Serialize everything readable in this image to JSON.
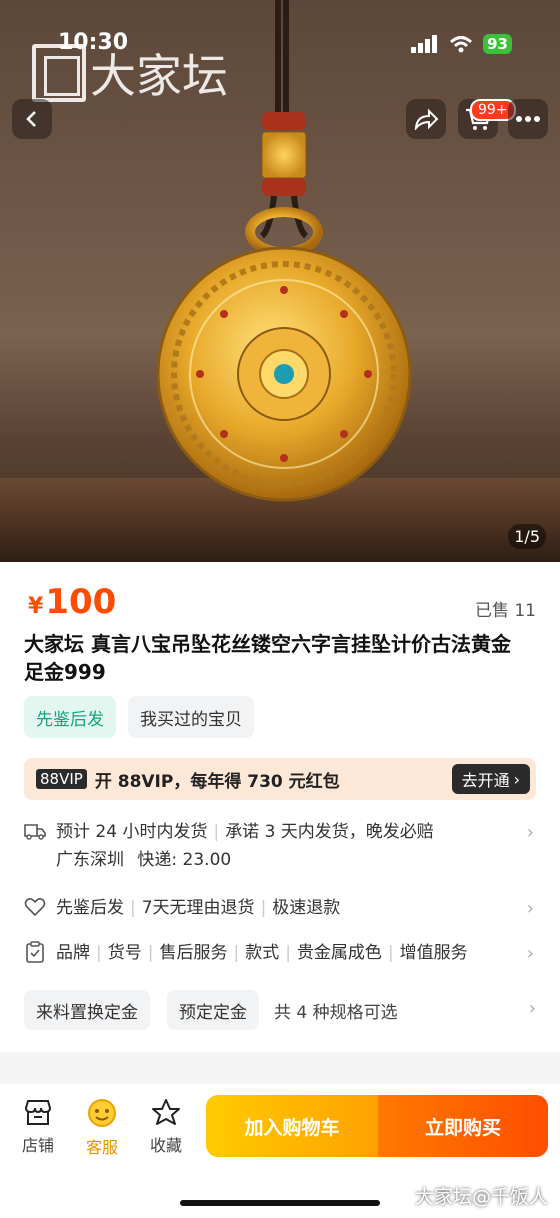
{
  "status_bar": {
    "time": "10:30",
    "battery": "93"
  },
  "watermark": {
    "logo_text": "大家坛",
    "bottom_text": "大家坛@千饭人"
  },
  "header": {
    "cart_badge": "99+"
  },
  "gallery": {
    "counter": "1/5"
  },
  "product": {
    "currency": "¥",
    "price": "100",
    "sold": "已售 11",
    "title": "大家坛 真言八宝吊坠花丝镂空六字言挂坠计价古法黄金 足金999",
    "tags": [
      "先鉴后发",
      "我买过的宝贝"
    ]
  },
  "vip": {
    "badge": "88VIP",
    "text": "开 88VIP，每年得 730 元红包",
    "button": "去开通"
  },
  "shipping": {
    "promise_1": "预计 24 小时内发货",
    "promise_2": "承诺 3 天内发货，晚发必赔",
    "origin": "广东深圳",
    "fee_label": "快递:",
    "fee": "23.00"
  },
  "services": [
    "先鉴后发",
    "7天无理由退货",
    "极速退款"
  ],
  "params": [
    "品牌",
    "货号",
    "售后服务",
    "款式",
    "贵金属成色",
    "增值服务"
  ],
  "specs": {
    "options": [
      "来料置换定金",
      "预定定金"
    ],
    "count_text": "共 4 种规格可选"
  },
  "bottom_bar": {
    "store": "店铺",
    "service": "客服",
    "favorite": "收藏",
    "add_to_cart": "加入购物车",
    "buy_now": "立即购买"
  },
  "colors": {
    "accent": "#ff4c00",
    "green": "#1aa37a",
    "cart_btn": "#ffb300",
    "buy_btn": "#ff5a00"
  }
}
